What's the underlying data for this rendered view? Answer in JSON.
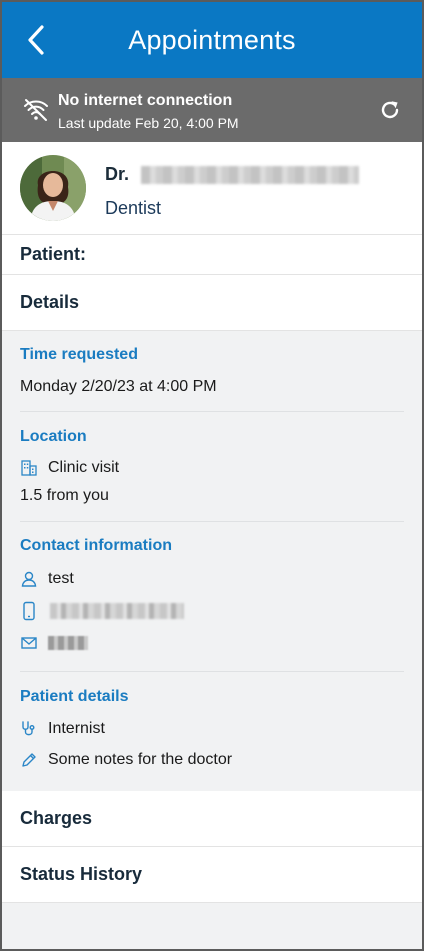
{
  "topbar": {
    "title": "Appointments"
  },
  "offline": {
    "title": "No internet connection",
    "last_update": "Last update Feb 20, 4:00 PM"
  },
  "doctor": {
    "prefix": "Dr.",
    "specialty": "Dentist"
  },
  "patient_label": "Patient:",
  "details_label": "Details",
  "time": {
    "heading": "Time requested",
    "value": "Monday 2/20/23 at 4:00 PM"
  },
  "location": {
    "heading": "Location",
    "visit_type": "Clinic visit",
    "distance": "1.5 from you"
  },
  "contact": {
    "heading": "Contact information",
    "name": "test"
  },
  "patient_details": {
    "heading": "Patient details",
    "specialty": "Internist",
    "notes": "Some notes for the doctor"
  },
  "charges_label": "Charges",
  "status_history_label": "Status History",
  "colors": {
    "topbar": "#0a78c4",
    "offline_bar": "#6b6b6b",
    "section_heading": "#1a7cc1"
  }
}
